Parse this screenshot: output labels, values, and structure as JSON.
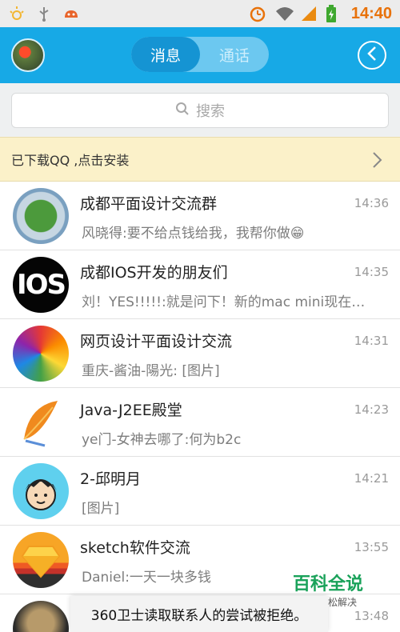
{
  "status_bar": {
    "time": "14:40",
    "icons": [
      "sun-icon",
      "usb-icon",
      "android-icon",
      "alarm-icon",
      "wifi-icon",
      "signal-icon",
      "battery-icon"
    ]
  },
  "header": {
    "tabs": [
      {
        "label": "消息",
        "active": true
      },
      {
        "label": "通话",
        "active": false
      }
    ],
    "accent_color": "#17a9e6"
  },
  "search": {
    "placeholder": "搜索"
  },
  "banner": {
    "text": "已下载QQ ,点击安装"
  },
  "conversations": [
    {
      "name": "成都平面设计交流群",
      "time": "14:36",
      "message": "风晓得:要不给点钱给我，我帮你做😁"
    },
    {
      "name": "成都IOS开发的朋友们",
      "time": "14:35",
      "message": "刘！YES!!!!!:就是问下！新的mac mini现在…"
    },
    {
      "name": "网页设计平面设计交流",
      "time": "14:31",
      "message": "重庆-酱油-陽光: [图片]"
    },
    {
      "name": "Java-J2EE殿堂",
      "time": "14:23",
      "message": "ye门-女神去哪了:何为b2c"
    },
    {
      "name": "2-邱明月",
      "time": "14:21",
      "message": "[图片]"
    },
    {
      "name": "sketch软件交流",
      "time": "13:55",
      "message": "Daniel:一天一块多钱"
    },
    {
      "name": "",
      "time": "13:48",
      "message": ""
    }
  ],
  "avatar_texts": {
    "ios": "IOS"
  },
  "toast": {
    "text": "360卫士读取联系人的尝试被拒绝。"
  },
  "watermark": {
    "title": "百科全说",
    "subtitle": "助你轻松解决"
  }
}
